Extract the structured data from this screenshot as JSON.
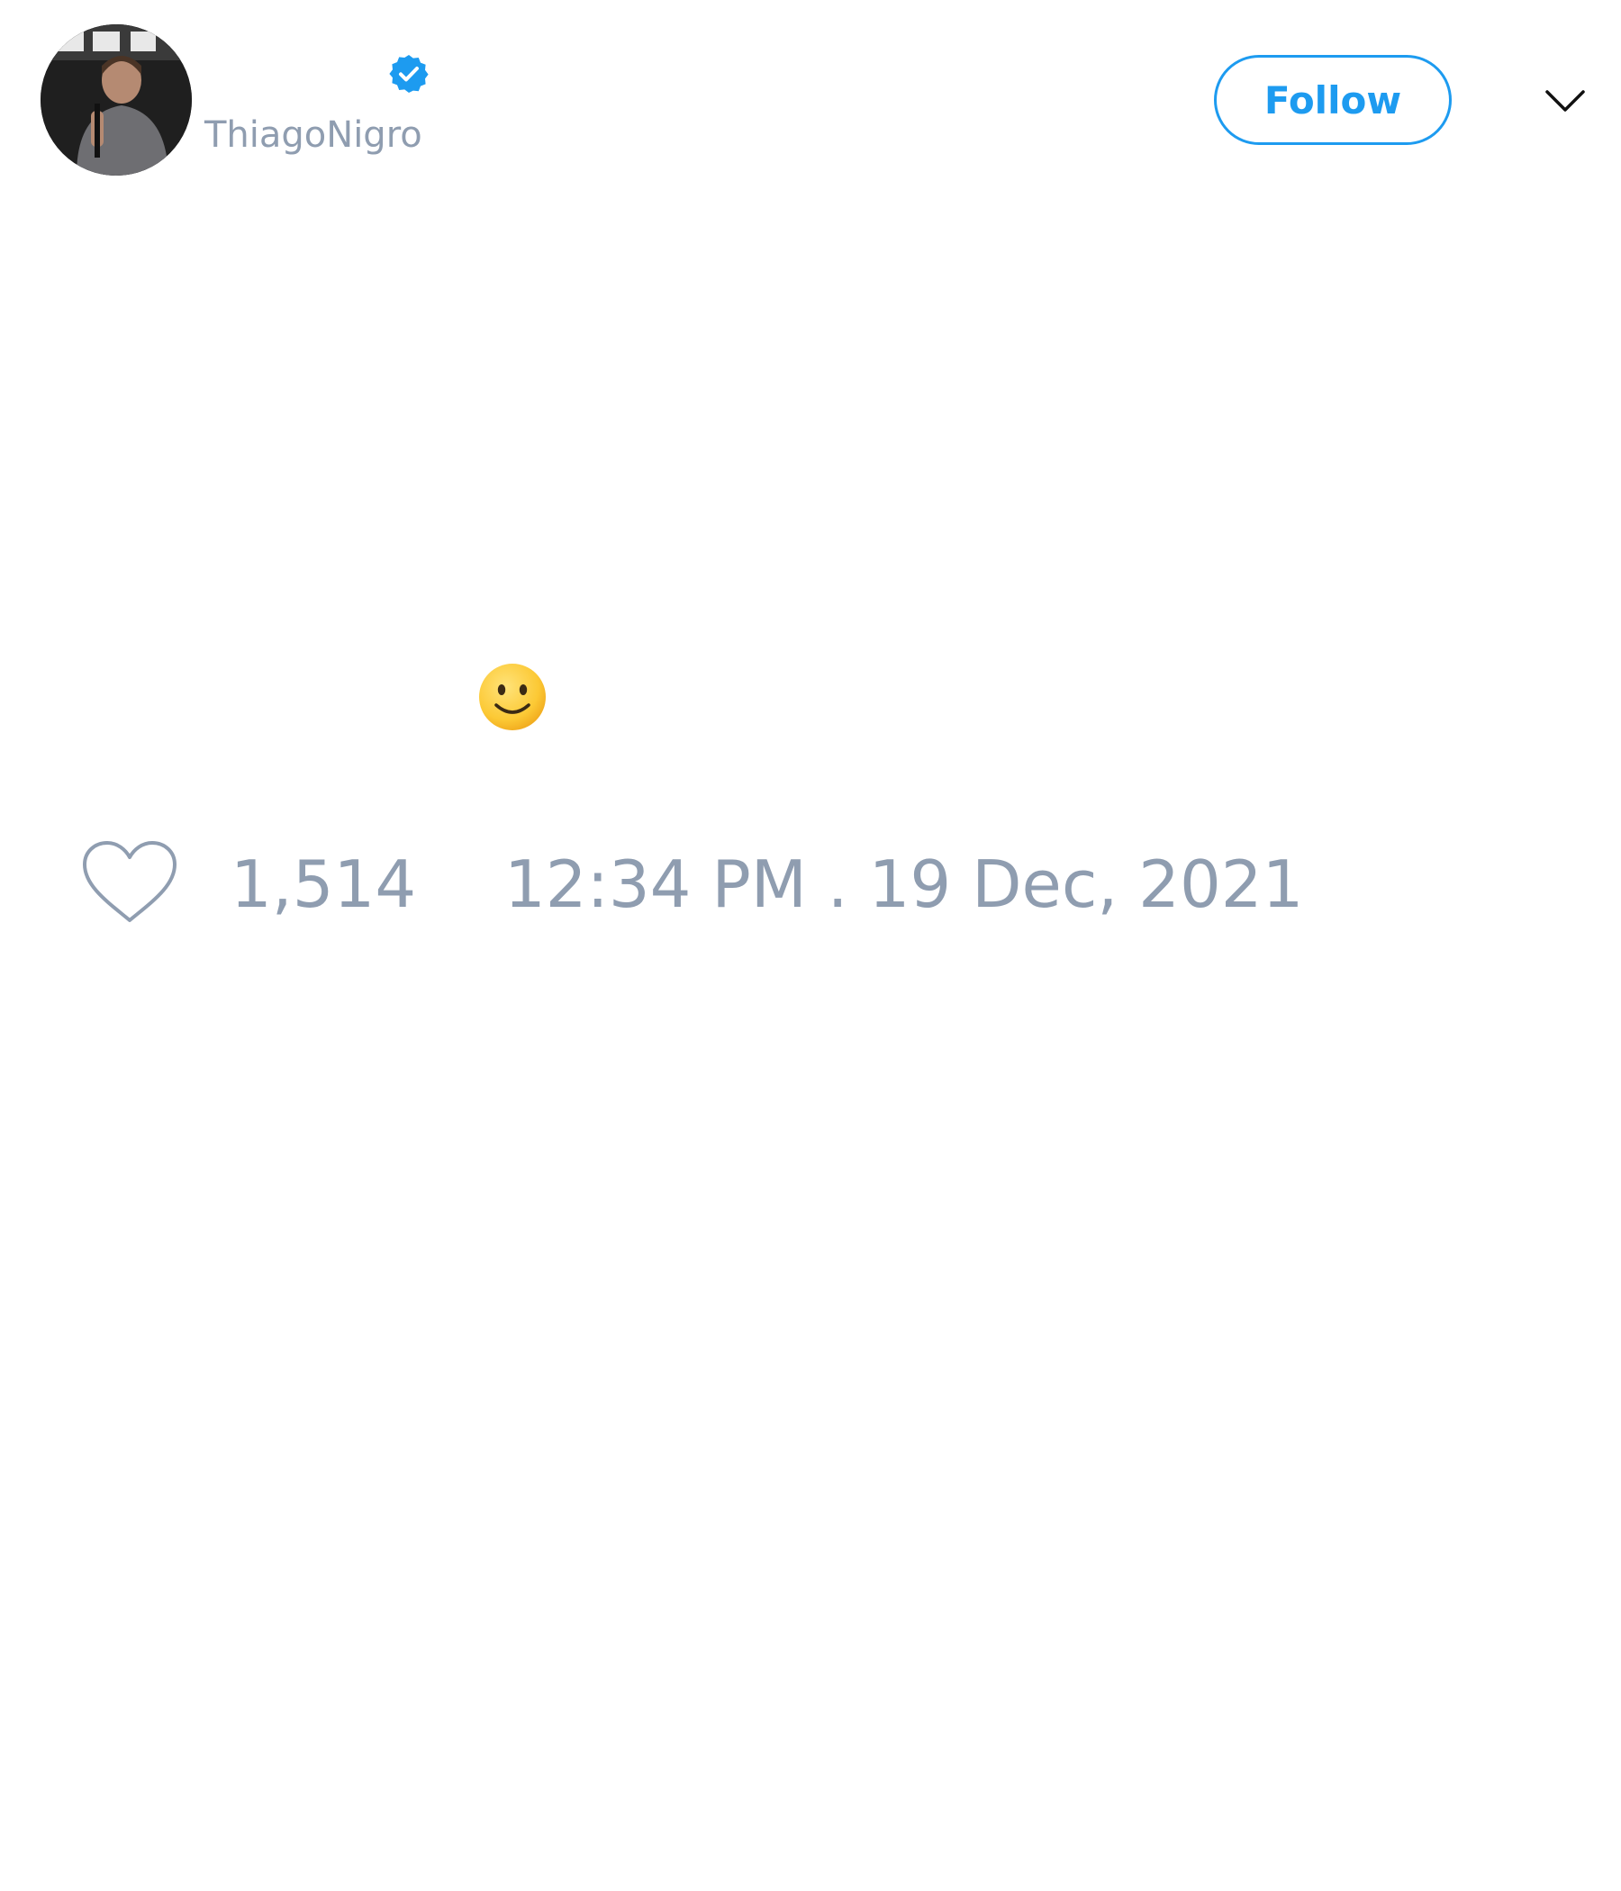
{
  "header": {
    "handle": "ThiagoNigro",
    "follow_label": "Follow",
    "verified": true
  },
  "icons": {
    "avatar": "avatar-photo",
    "verified": "verified-badge-icon",
    "caret": "chevron-down-icon",
    "emoji": "slightly-smiling-face-emoji",
    "like": "heart-outline-icon"
  },
  "tweet": {
    "emoji": "🙂"
  },
  "footer": {
    "like_count": "1,514",
    "timestamp": "12:34 PM . 19 Dec, 2021"
  },
  "colors": {
    "accent": "#1d9bf0",
    "muted": "#8f9db0",
    "background": "#ffffff"
  }
}
